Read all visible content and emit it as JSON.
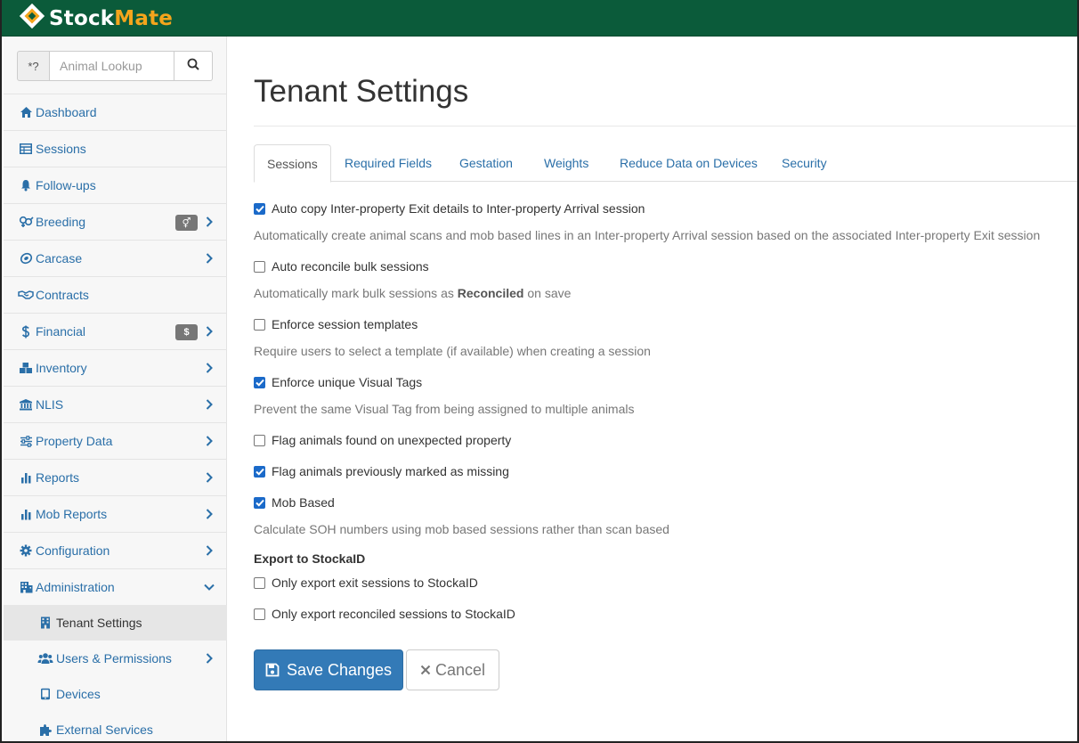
{
  "app": {
    "name_part1": "Stock",
    "name_part2": "Mate",
    "brand_color": "#0b5b3a",
    "accent_color": "#f4a51c"
  },
  "lookup": {
    "prefix": "*?",
    "placeholder": "Animal Lookup",
    "search_icon": "search-icon"
  },
  "sidebar": {
    "items": [
      {
        "label": "Dashboard",
        "icon": "home-icon"
      },
      {
        "label": "Sessions",
        "icon": "table-icon"
      },
      {
        "label": "Follow-ups",
        "icon": "bell-icon"
      },
      {
        "label": "Breeding",
        "icon": "breeding-icon",
        "badge": "⚥"
      },
      {
        "label": "Carcase",
        "icon": "carcase-icon"
      },
      {
        "label": "Contracts",
        "icon": "handshake-icon"
      },
      {
        "label": "Financial",
        "icon": "dollar-icon",
        "badge": "$"
      },
      {
        "label": "Inventory",
        "icon": "boxes-icon"
      },
      {
        "label": "NLIS",
        "icon": "bank-icon"
      },
      {
        "label": "Property Data",
        "icon": "sliders-icon"
      },
      {
        "label": "Reports",
        "icon": "bar-chart-icon"
      },
      {
        "label": "Mob Reports",
        "icon": "bar-chart-icon"
      },
      {
        "label": "Configuration",
        "icon": "gear-icon"
      },
      {
        "label": "Administration",
        "icon": "building-icon"
      }
    ],
    "sub_items": [
      {
        "label": "Tenant Settings",
        "icon": "building-icon"
      },
      {
        "label": "Users & Permissions",
        "icon": "users-icon"
      },
      {
        "label": "Devices",
        "icon": "tablet-icon"
      },
      {
        "label": "External Services",
        "icon": "puzzle-icon"
      }
    ]
  },
  "main": {
    "title": "Tenant Settings",
    "tabs": [
      "Sessions",
      "Required Fields",
      "Gestation",
      "Weights",
      "Reduce Data on Devices",
      "Security"
    ],
    "options": [
      {
        "label": "Auto copy Inter-property Exit details to Inter-property Arrival session",
        "checked": true,
        "help": "Automatically create animal scans and mob based lines in an Inter-property Arrival session based on the associated Inter-property Exit session"
      },
      {
        "label": "Auto reconcile bulk sessions",
        "checked": false,
        "help_pre": "Automatically mark bulk sessions as ",
        "help_bold": "Reconciled",
        "help_post": " on save"
      },
      {
        "label": "Enforce session templates",
        "checked": false,
        "help": "Require users to select a template (if available) when creating a session"
      },
      {
        "label": "Enforce unique Visual Tags",
        "checked": true,
        "help": "Prevent the same Visual Tag from being assigned to multiple animals"
      },
      {
        "label": "Flag animals found on unexpected property",
        "checked": false
      },
      {
        "label": "Flag animals previously marked as missing",
        "checked": true
      },
      {
        "label": "Mob Based",
        "checked": true,
        "help": "Calculate SOH numbers using mob based sessions rather than scan based"
      }
    ],
    "export_section": {
      "heading": "Export to StockaID",
      "options": [
        {
          "label": "Only export exit sessions to StockaID",
          "checked": false
        },
        {
          "label": "Only export reconciled sessions to StockaID",
          "checked": false
        }
      ]
    },
    "save_label": "Save Changes",
    "cancel_label": "Cancel"
  }
}
